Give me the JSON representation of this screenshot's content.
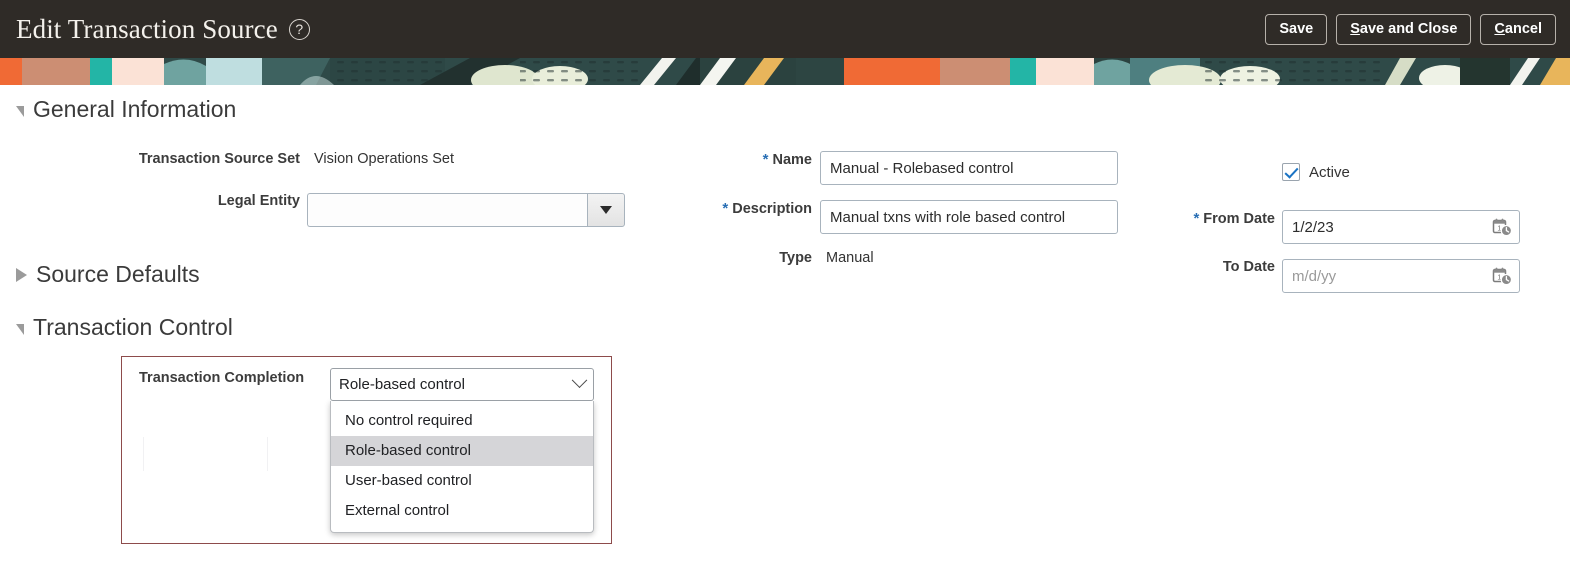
{
  "header": {
    "title": "Edit Transaction Source",
    "help_icon": "help-circle-icon",
    "buttons": [
      {
        "label": "Save",
        "accesskey": ""
      },
      {
        "label": "Save and Close",
        "accesskey": "S"
      },
      {
        "label": "Cancel",
        "accesskey": "C"
      }
    ]
  },
  "sections": {
    "general": {
      "title": "General Information",
      "state": "expanded"
    },
    "source_defaults": {
      "title": "Source Defaults",
      "state": "collapsed"
    },
    "transaction_control": {
      "title": "Transaction Control",
      "state": "expanded"
    }
  },
  "general": {
    "transaction_source_set": {
      "label": "Transaction Source Set",
      "value": "Vision Operations Set"
    },
    "legal_entity": {
      "label": "Legal Entity",
      "value": "",
      "dropdown_icon": "caret-down-icon"
    },
    "name": {
      "label": "Name",
      "required": "*",
      "value": "Manual - Rolebased control"
    },
    "description": {
      "label": "Description",
      "required": "*",
      "value": "Manual txns with role based control"
    },
    "type": {
      "label": "Type",
      "value": "Manual"
    },
    "active": {
      "label": "Active",
      "checked": true
    },
    "from_date": {
      "label": "From Date",
      "required": "*",
      "value": "1/2/23",
      "placeholder": "m/d/yy",
      "icon": "calendar-clock-icon"
    },
    "to_date": {
      "label": "To Date",
      "value": "",
      "placeholder": "m/d/yy",
      "icon": "calendar-clock-icon"
    }
  },
  "transaction_control": {
    "completion": {
      "label": "Transaction Completion",
      "selected": "Role-based control",
      "chevron_icon": "chevron-down-icon",
      "options": [
        "No control required",
        "Role-based control",
        "User-based control",
        "External control"
      ],
      "highlighted_option": "Role-based control"
    },
    "panel_border_color": "#8d4b4b"
  },
  "colors": {
    "header_bg": "#2f2b27",
    "required_marker": "#286eb4",
    "checkbox_check": "#1a73c4",
    "section_title": "#3b3b3b",
    "field_border": "#a8b3bd"
  }
}
